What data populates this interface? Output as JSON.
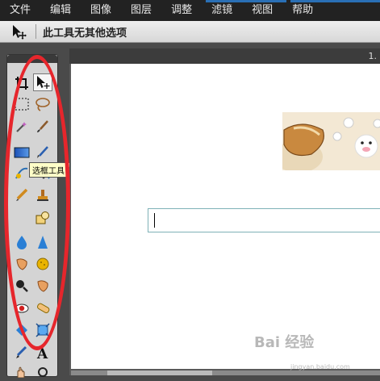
{
  "menu": {
    "items": [
      "文件",
      "编辑",
      "图像",
      "图层",
      "调整",
      "滤镜",
      "视图",
      "帮助"
    ]
  },
  "options_bar": {
    "message": "此工具无其他选项",
    "tool_icon": "move-tool-icon"
  },
  "toolbox": {
    "tooltip": "选框工具 (M)",
    "tools": [
      "crop-icon",
      "move-icon",
      "marquee-icon",
      "lasso-icon",
      "magic-wand-icon",
      "brush-icon",
      "gradient-icon",
      "pencil-brush-icon",
      "clone-icon",
      "paint-bucket-icon",
      "pencil-icon",
      "stamp-icon",
      "shape-icon",
      "blur-icon",
      "sharpen-icon",
      "smudge-icon",
      "sponge-icon",
      "zoom-icon",
      "burn-icon",
      "red-eye-icon",
      "healing-icon",
      "transform-icon",
      "scale-icon",
      "eyedropper-icon",
      "text-icon",
      "hand-icon",
      "zoom-small-icon"
    ]
  },
  "document": {
    "title": "1."
  },
  "watermark": {
    "text": "Bai 经验",
    "sub": "jingyan.baidu.com"
  },
  "colors": {
    "accent": "#2a6fb5",
    "annotation": "#e6262c"
  }
}
